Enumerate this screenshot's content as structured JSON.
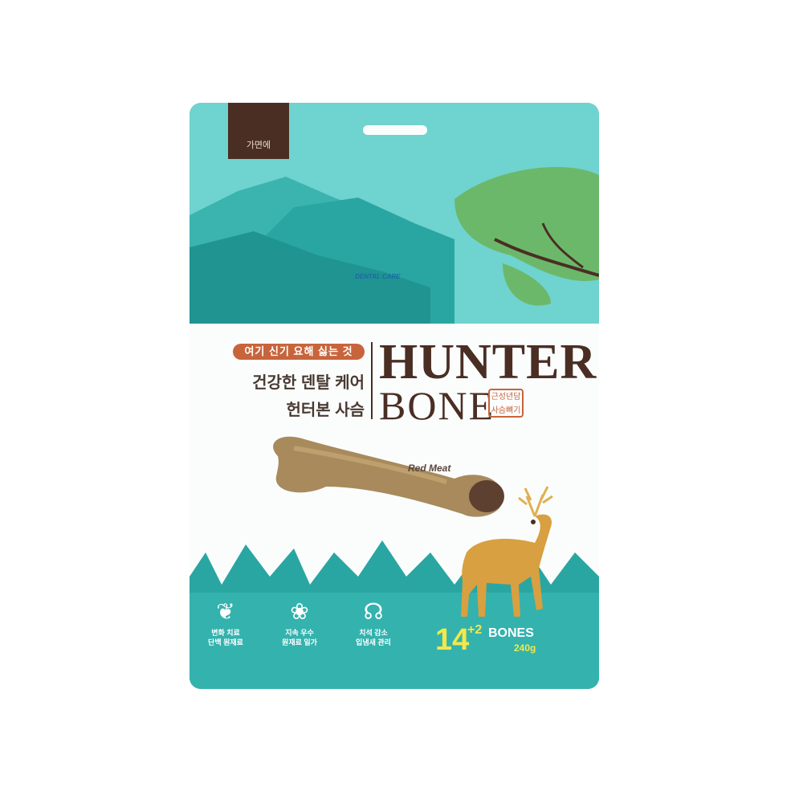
{
  "product": {
    "brand_mark": "가면에",
    "promo_label": "여기 신기 요해 싫는 것",
    "subtitle_line1": "건강한 덴탈 케어",
    "subtitle_line2": "헌터본 사슴",
    "title_word1": "HUNTER",
    "title_word2": "BONE",
    "flavor_tag_line1": "근성년담",
    "flavor_tag_line2": "사슴뼈기",
    "meat_label": "Red Meat",
    "badge_text": "DENTAL CARE",
    "count_main": "14",
    "count_bonus": "+2",
    "count_unit": "BONES",
    "weight": "240g"
  },
  "features": [
    {
      "icon": "plant-icon",
      "label_line1": "변화 치료",
      "label_line2": "단백 원재료"
    },
    {
      "icon": "leaf-icon",
      "label_line1": "지속 우수",
      "label_line2": "원재료 일가"
    },
    {
      "icon": "chew-icon",
      "label_line1": "치석 감소",
      "label_line2": "입냄새 관리"
    }
  ],
  "colors": {
    "pouch_teal": "#5cc8c4",
    "pouch_teal_dark": "#2aa6a2",
    "brand_brown": "#4a2e24",
    "accent_orange": "#c8643c",
    "count_yellow": "#f2e84a"
  }
}
